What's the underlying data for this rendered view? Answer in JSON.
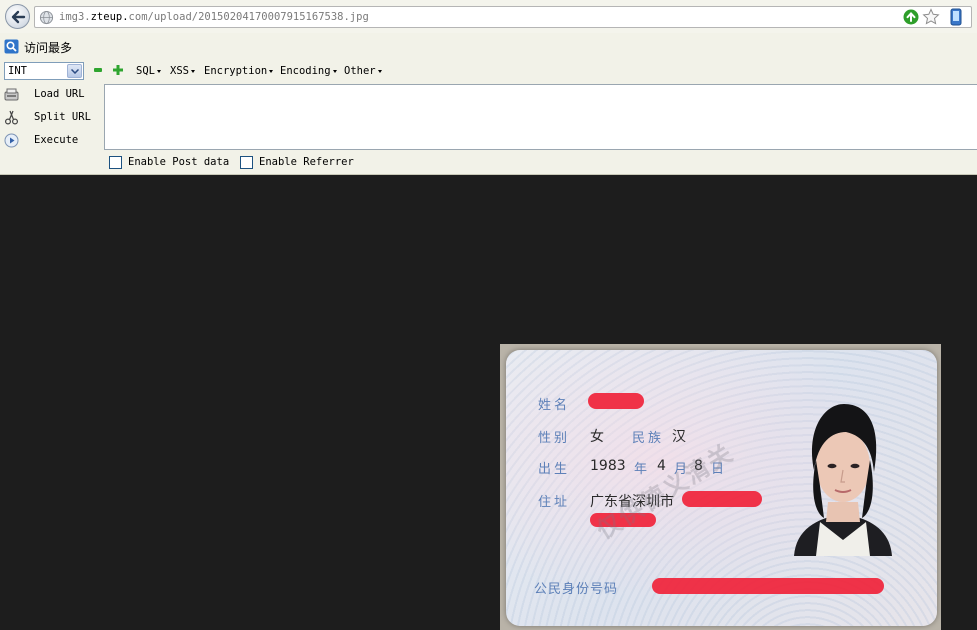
{
  "browser": {
    "url_host": "img3.",
    "url_domain": "zteup.",
    "url_rest": "com/upload/20150204170007915167538.jpg"
  },
  "bookmarks": {
    "item_label": "访问最多"
  },
  "hackbar": {
    "type_select_value": "INT",
    "menus": [
      "SQL",
      "XSS",
      "Encryption",
      "Encoding",
      "Other"
    ],
    "load_url": "Load URL",
    "split_url": "Split URL",
    "execute": "Execute",
    "textarea_value": "",
    "enable_post": "Enable Post data",
    "enable_referrer": "Enable Referrer"
  },
  "id_card": {
    "name_label": "姓名",
    "sex_label": "性别",
    "sex_value": "女",
    "ethnicity_label": "民族",
    "ethnicity_value": "汉",
    "birth_label": "出生",
    "birth_year": "1983",
    "year_unit": "年",
    "birth_month": "4",
    "month_unit": "月",
    "birth_day": "8",
    "day_unit": "日",
    "address_label": "住址",
    "address_value": "广东省深圳市",
    "id_number_label": "公民身份号码",
    "watermark": "仅供德义清关"
  },
  "colors": {
    "chrome_bg": "#f2f2e8",
    "viewport_bg": "#1d1d1d",
    "card_label": "#5d80b8",
    "redaction": "#f0233a"
  }
}
